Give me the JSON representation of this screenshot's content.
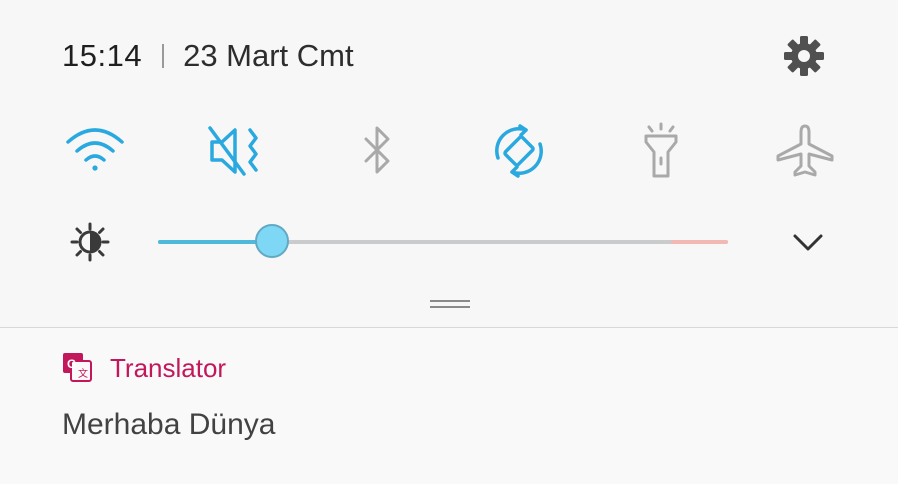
{
  "status": {
    "time": "15:14",
    "date": "23 Mart Cmt"
  },
  "quick_settings": [
    {
      "id": "wifi",
      "icon": "wifi-icon",
      "active": true
    },
    {
      "id": "sound",
      "icon": "vibrate-mute-icon",
      "active": true
    },
    {
      "id": "bluetooth",
      "icon": "bluetooth-icon",
      "active": false
    },
    {
      "id": "auto-rotate",
      "icon": "auto-rotate-icon",
      "active": true
    },
    {
      "id": "flashlight",
      "icon": "flashlight-icon",
      "active": false
    },
    {
      "id": "airplane",
      "icon": "airplane-icon",
      "active": false
    }
  ],
  "brightness": {
    "level": 0.2,
    "warn_threshold": 0.9
  },
  "colors": {
    "active": "#2aa8e0",
    "inactive": "#a9a9a9",
    "app_accent": "#c2185b"
  },
  "notification": {
    "app_name": "Translator",
    "text": "Merhaba Dünya",
    "icon": "google-translate-icon"
  }
}
